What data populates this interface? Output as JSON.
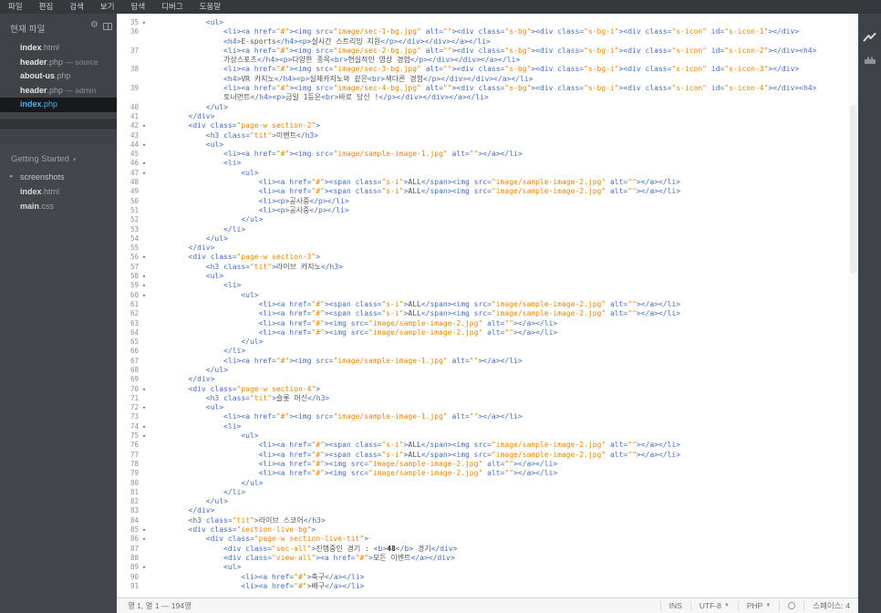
{
  "menubar": {
    "items": [
      "파일",
      "편집",
      "검색",
      "보기",
      "탐색",
      "디버그",
      "도움말"
    ]
  },
  "sidebar": {
    "working_files_header": "현재 파일",
    "working_files": [
      {
        "name": "index",
        "ext": ".html",
        "suffix": "",
        "active": false
      },
      {
        "name": "header",
        "ext": ".php",
        "suffix": " — source",
        "active": false
      },
      {
        "name": "about-us",
        "ext": ".php",
        "suffix": "",
        "active": false
      },
      {
        "name": "header",
        "ext": ".php",
        "suffix": " — admin",
        "active": false
      },
      {
        "name": "index",
        "ext": ".php",
        "suffix": "",
        "active": true
      }
    ],
    "project_header": "Getting Started",
    "tree": [
      {
        "name": "screenshots",
        "ext": "",
        "folder": true
      },
      {
        "name": "index",
        "ext": ".html",
        "folder": false
      },
      {
        "name": "main",
        "ext": ".css",
        "folder": false
      }
    ]
  },
  "icons": {
    "sidebar": [
      "gear-icon",
      "split-view-icon"
    ],
    "right_bar": [
      "live-preview-lightning-icon",
      "extension-manager-brick-icon"
    ],
    "statusbar": [
      "problems-circle-icon"
    ]
  },
  "editor": {
    "lines": [
      {
        "n": 35,
        "f": 1,
        "i": 12,
        "t": "<ul>"
      },
      {
        "n": 36,
        "f": 0,
        "i": 16,
        "t": "<li><a href=\"#\"><img src=\"image/sec-1-bg.jpg\" alt=\"\"><div class=\"s-bg\"><div class=\"s-bg-i\"><div class=\"s-icon\" id=\"s-icon-1\"></div>",
        "t2": "<h4>E-sports</h4><p>실시간 스트리밍 지원</p></div></div></a></li>"
      },
      {
        "n": 37,
        "f": 0,
        "i": 16,
        "t": "<li><a href=\"#\"><img src=\"image/sec-2-bg.jpg\" alt=\"\"><div class=\"s-bg\"><div class=\"s-bg-i\"><div class=\"s-icon\" id=\"s-icon-2\"></div><h4>",
        "t2": "가상스포츠</h4><p>다양한 종목<br>현실적인 영상 경험</p></div></div></a></li>"
      },
      {
        "n": 38,
        "f": 0,
        "i": 16,
        "t": "<li><a href=\"#\"><img src=\"image/sec-3-bg.jpg\" alt=\"\"><div class=\"s-bg\"><div class=\"s-bg-i\"><div class=\"s-icon\" id=\"s-icon-3\"></div>",
        "t2": "<h4>VR 카지노</h4><p>실제카지노와 같은<br>색다른 경험</p></div></div></a></li>"
      },
      {
        "n": 39,
        "f": 0,
        "i": 16,
        "t": "<li><a href=\"#\"><img src=\"image/sec-4-bg.jpg\" alt=\"\"><div class=\"s-bg\"><div class=\"s-bg-i\"><div class=\"s-icon\" id=\"s-icon-4\"></div><h4>",
        "t2": "토너먼트</h4><p>금일 1등은<br>바로 당신 !</p></div></div></a></li>"
      },
      {
        "n": 40,
        "f": 0,
        "i": 12,
        "t": "</ul>"
      },
      {
        "n": 41,
        "f": 0,
        "i": 8,
        "t": "</div>"
      },
      {
        "n": 42,
        "f": 1,
        "i": 8,
        "t": "<div class=\"page-w section-2\">"
      },
      {
        "n": 43,
        "f": 0,
        "i": 12,
        "t": "<h3 class=\"tit\">이벤트</h3>"
      },
      {
        "n": 44,
        "f": 1,
        "i": 12,
        "t": "<ul>"
      },
      {
        "n": 45,
        "f": 0,
        "i": 16,
        "t": "<li><a href=\"#\"><img src=\"image/sample-image-1.jpg\" alt=\"\"></a></li>"
      },
      {
        "n": 46,
        "f": 1,
        "i": 16,
        "t": "<li>"
      },
      {
        "n": 47,
        "f": 1,
        "i": 20,
        "t": "<ul>"
      },
      {
        "n": 48,
        "f": 0,
        "i": 24,
        "t": "<li><a href=\"#\"><span class=\"s-i\">ALL</span><img src=\"image/sample-image-2.jpg\" alt=\"\"></a></li>"
      },
      {
        "n": 49,
        "f": 0,
        "i": 24,
        "t": "<li><a href=\"#\"><span class=\"s-i\">ALL</span><img src=\"image/sample-image-2.jpg\" alt=\"\"></a></li>"
      },
      {
        "n": 50,
        "f": 0,
        "i": 24,
        "t": "<li><p>공사중</p></li>"
      },
      {
        "n": 51,
        "f": 0,
        "i": 24,
        "t": "<li><p>공사중</p></li>"
      },
      {
        "n": 52,
        "f": 0,
        "i": 20,
        "t": "</ul>"
      },
      {
        "n": 53,
        "f": 0,
        "i": 16,
        "t": "</li>"
      },
      {
        "n": 54,
        "f": 0,
        "i": 12,
        "t": "</ul>"
      },
      {
        "n": 55,
        "f": 0,
        "i": 8,
        "t": "</div>"
      },
      {
        "n": 56,
        "f": 1,
        "i": 8,
        "t": "<div class=\"page-w section-3\">"
      },
      {
        "n": 57,
        "f": 0,
        "i": 12,
        "t": "<h3 class=\"tit\">라이브 카지노</h3>"
      },
      {
        "n": 58,
        "f": 1,
        "i": 12,
        "t": "<ul>"
      },
      {
        "n": 59,
        "f": 1,
        "i": 16,
        "t": "<li>"
      },
      {
        "n": 60,
        "f": 1,
        "i": 20,
        "t": "<ul>"
      },
      {
        "n": 61,
        "f": 0,
        "i": 24,
        "t": "<li><a href=\"#\"><span class=\"s-i\">ALL</span><img src=\"image/sample-image-2.jpg\" alt=\"\"></a></li>"
      },
      {
        "n": 62,
        "f": 0,
        "i": 24,
        "t": "<li><a href=\"#\"><span class=\"s-i\">ALL</span><img src=\"image/sample-image-2.jpg\" alt=\"\"></a></li>"
      },
      {
        "n": 63,
        "f": 0,
        "i": 24,
        "t": "<li><a href=\"#\"><img src=\"image/sample-image-2.jpg\" alt=\"\"></a></li>"
      },
      {
        "n": 64,
        "f": 0,
        "i": 24,
        "t": "<li><a href=\"#\"><img src=\"image/sample-image-2.jpg\" alt=\"\"></a></li>"
      },
      {
        "n": 65,
        "f": 0,
        "i": 20,
        "t": "</ul>"
      },
      {
        "n": 66,
        "f": 0,
        "i": 16,
        "t": "</li>"
      },
      {
        "n": 67,
        "f": 0,
        "i": 16,
        "t": "<li><a href=\"#\"><img src=\"image/sample-image-1.jpg\" alt=\"\"></a></li>"
      },
      {
        "n": 68,
        "f": 0,
        "i": 12,
        "t": "</ul>"
      },
      {
        "n": 69,
        "f": 0,
        "i": 8,
        "t": "</div>"
      },
      {
        "n": 70,
        "f": 1,
        "i": 8,
        "t": "<div class=\"page-w section-4\">"
      },
      {
        "n": 71,
        "f": 0,
        "i": 12,
        "t": "<h3 class=\"tit\">슬롯 머신</h3>"
      },
      {
        "n": 72,
        "f": 1,
        "i": 12,
        "t": "<ul>"
      },
      {
        "n": 73,
        "f": 0,
        "i": 16,
        "t": "<li><a href=\"#\"><img src=\"image/sample-image-1.jpg\" alt=\"\"></a></li>"
      },
      {
        "n": 74,
        "f": 1,
        "i": 16,
        "t": "<li>"
      },
      {
        "n": 75,
        "f": 1,
        "i": 20,
        "t": "<ul>"
      },
      {
        "n": 76,
        "f": 0,
        "i": 24,
        "t": "<li><a href=\"#\"><span class=\"s-i\">ALL</span><img src=\"image/sample-image-2.jpg\" alt=\"\"></a></li>"
      },
      {
        "n": 77,
        "f": 0,
        "i": 24,
        "t": "<li><a href=\"#\"><span class=\"s-i\">ALL</span><img src=\"image/sample-image-2.jpg\" alt=\"\"></a></li>"
      },
      {
        "n": 78,
        "f": 0,
        "i": 24,
        "t": "<li><a href=\"#\"><img src=\"image/sample-image-2.jpg\" alt=\"\"></a></li>"
      },
      {
        "n": 79,
        "f": 0,
        "i": 24,
        "t": "<li><a href=\"#\"><img src=\"image/sample-image-2.jpg\" alt=\"\"></a></li>"
      },
      {
        "n": 80,
        "f": 0,
        "i": 20,
        "t": "</ul>"
      },
      {
        "n": 81,
        "f": 0,
        "i": 16,
        "t": "</li>"
      },
      {
        "n": 82,
        "f": 0,
        "i": 12,
        "t": "</ul>"
      },
      {
        "n": 83,
        "f": 0,
        "i": 8,
        "t": "</div>"
      },
      {
        "n": 84,
        "f": 0,
        "i": 8,
        "t": "<h3 class=\"tit\">라이브 스코어</h3>"
      },
      {
        "n": 85,
        "f": 1,
        "i": 8,
        "t": "<div class=\"section-live-bg\">"
      },
      {
        "n": 86,
        "f": 1,
        "i": 12,
        "t": "<div class=\"page-w section-live-tit\">"
      },
      {
        "n": 87,
        "f": 0,
        "i": 16,
        "t": "<div class=\"sec-all\">진행중인 경기 : <b>48</b> 경기</div>"
      },
      {
        "n": 88,
        "f": 0,
        "i": 16,
        "t": "<div class=\"view-all\"><a href=\"#\">모든 이벤트</a></div>"
      },
      {
        "n": 89,
        "f": 1,
        "i": 16,
        "t": "<ul>"
      },
      {
        "n": 90,
        "f": 0,
        "i": 20,
        "t": "<li><a href=\"#\">축구</a></li>"
      },
      {
        "n": 91,
        "f": 0,
        "i": 20,
        "t": "<li><a href=\"#\">배구</a></li>"
      }
    ]
  },
  "statusbar": {
    "cursor": "행 1, 열 1 — 194행",
    "overwrite": "INS",
    "encoding": "UTF-8",
    "language": "PHP",
    "spaces": "스페이스: 4"
  },
  "colors": {
    "menubar-bg": "#35383c",
    "sidebar-bg": "#3f4348",
    "sidebar-proj-bg": "#43474c",
    "active-file-bg": "#17191c",
    "active-file-fg": "#4cb1f2",
    "editor-bg": "#ffffff",
    "iconbar-bg": "#3f4348",
    "tag": "#446fbd",
    "string": "#e88501",
    "text": "#535353",
    "linenum": "#909090",
    "status-bg": "#f6f6f6",
    "status-fg": "#6f6f6f"
  }
}
